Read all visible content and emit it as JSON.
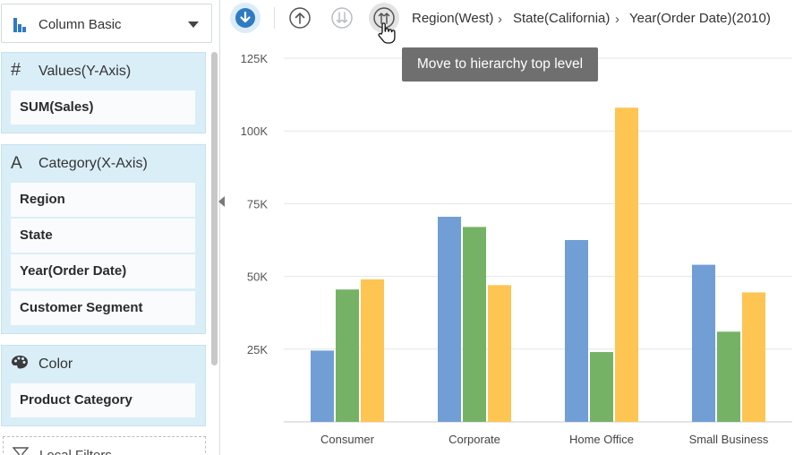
{
  "left_panel": {
    "chart_type": {
      "label": "Column Basic",
      "icon": "bar-chart-icon"
    },
    "values_section": {
      "title": "Values(Y-Axis)",
      "icon": "hash-icon",
      "fields": [
        "SUM(Sales)"
      ]
    },
    "category_section": {
      "title": "Category(X-Axis)",
      "icon": "letter-a-icon",
      "fields": [
        "Region",
        "State",
        "Year(Order Date)",
        "Customer Segment"
      ]
    },
    "color_section": {
      "title": "Color",
      "icon": "palette-icon",
      "fields": [
        "Product Category"
      ]
    },
    "local_filters": {
      "label": "Local Filters",
      "icon": "filter-icon"
    }
  },
  "toolbar": {
    "drill_down_icon": "arrow-down-circle-icon",
    "drill_up_icon": "arrow-up-circle-icon",
    "drill_down_all_icon": "double-arrow-down-icon",
    "drill_top_icon": "double-arrow-up-icon",
    "breadcrumbs": [
      "Region(West)",
      "State(California)",
      "Year(Order Date)(2010)"
    ],
    "tooltip": "Move to hierarchy top level"
  },
  "colors": {
    "series1": "#719ed5",
    "series2": "#75b266",
    "series3": "#fec553",
    "accent": "#2f7bc2",
    "panel_bg": "#daeef7"
  },
  "chart_data": {
    "type": "bar",
    "categories": [
      "Consumer",
      "Corporate",
      "Home Office",
      "Small Business"
    ],
    "series": [
      {
        "values": [
          24500,
          70500,
          62500,
          54000
        ]
      },
      {
        "values": [
          45500,
          67000,
          24000,
          31000
        ]
      },
      {
        "values": [
          49000,
          47000,
          108000,
          44500
        ]
      }
    ],
    "ylim": [
      0,
      125000
    ],
    "yticks": [
      "25K",
      "50K",
      "75K",
      "100K",
      "125K"
    ],
    "ytick_values": [
      25000,
      50000,
      75000,
      100000,
      125000
    ],
    "grid": true,
    "title": "",
    "xlabel": "",
    "ylabel": ""
  }
}
